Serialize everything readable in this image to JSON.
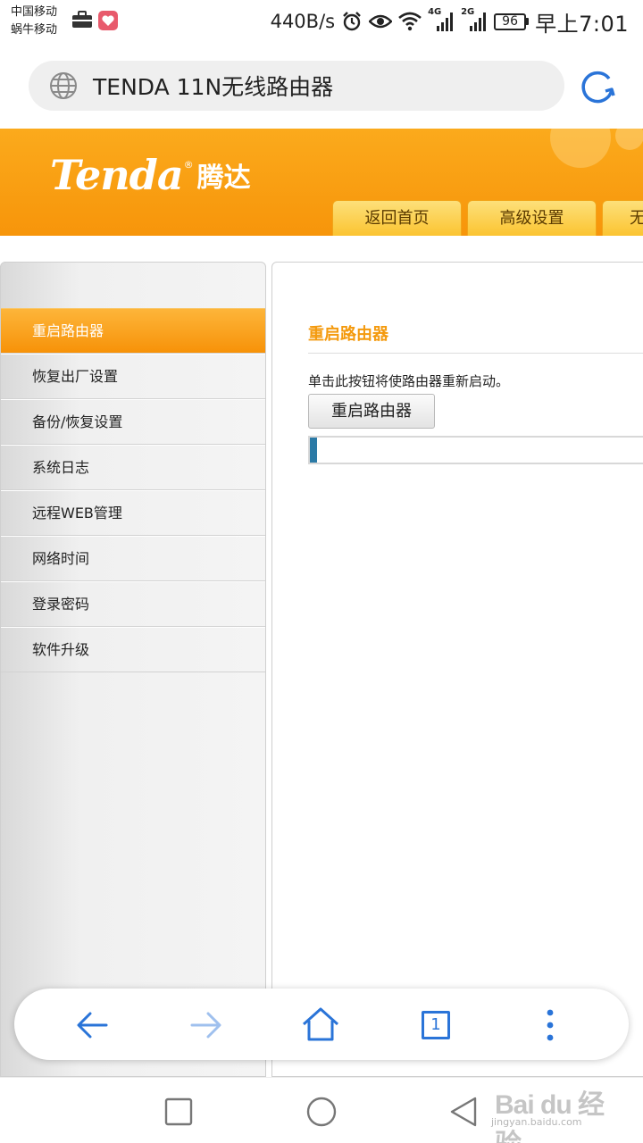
{
  "status_bar": {
    "carrier_1": "中国移动",
    "carrier_2": "蜗牛移动",
    "speed": "440B/s",
    "net_4g": "4G",
    "net_2g": "2G",
    "battery": "96",
    "time": "早上7:01",
    "icons": [
      "briefcase-icon",
      "heart-icon",
      "alarm-icon",
      "eye-icon",
      "wifi-icon",
      "signal-icon"
    ]
  },
  "address_bar": {
    "url": "TENDA 11N无线路由器"
  },
  "router_header": {
    "logo_en": "Tenda",
    "logo_reg": "®",
    "logo_cn": "腾达",
    "tabs": [
      "返回首页",
      "高级设置",
      "无"
    ],
    "accent": "#f7950a"
  },
  "sidebar": {
    "items": [
      {
        "label": "重启路由器",
        "active": true
      },
      {
        "label": "恢复出厂设置"
      },
      {
        "label": "备份/恢复设置"
      },
      {
        "label": "系统日志"
      },
      {
        "label": "远程WEB管理"
      },
      {
        "label": "网络时间"
      },
      {
        "label": "登录密码"
      },
      {
        "label": "软件升级"
      }
    ]
  },
  "main": {
    "title": "重启路由器",
    "description": "单击此按钮将使路由器重新启动。",
    "reboot_button": "重启路由器",
    "progress_fraction": 0.02,
    "title_color": "#f49a0e"
  },
  "browser_toolbar": {
    "tab_count": "1",
    "icon_color": "#2a74d8"
  },
  "watermark": {
    "brand": "Bai du 经验",
    "site": "jingyan.baidu.com"
  }
}
